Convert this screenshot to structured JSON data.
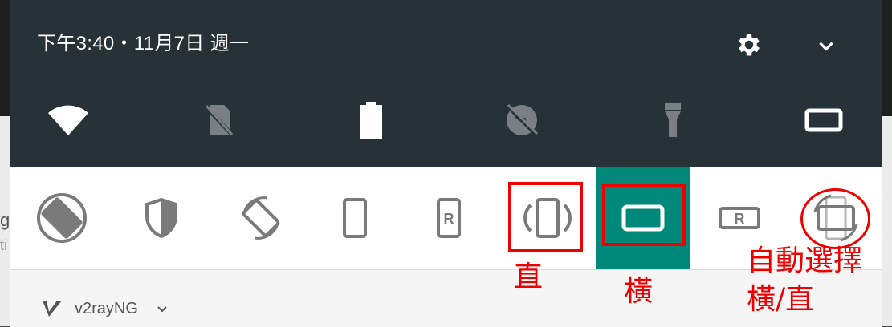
{
  "status": {
    "datetime": "下午3:40・11月7日 週一"
  },
  "header_icons": [
    "settings-gear-icon",
    "chevron-down-icon"
  ],
  "quick_settings": [
    {
      "name": "wifi-icon"
    },
    {
      "name": "no-sim-icon"
    },
    {
      "name": "battery-icon"
    },
    {
      "name": "data-saver-off-icon"
    },
    {
      "name": "flashlight-off-icon"
    },
    {
      "name": "screen-orientation-icon"
    }
  ],
  "rotation_options": [
    {
      "name": "auto-rotate-filled-icon"
    },
    {
      "name": "shield-icon"
    },
    {
      "name": "auto-rotate-icon"
    },
    {
      "name": "portrait-phone-icon"
    },
    {
      "name": "portrait-reverse-icon",
      "letter": "R"
    },
    {
      "name": "portrait-sensor-icon"
    },
    {
      "name": "landscape-icon",
      "selected": true
    },
    {
      "name": "landscape-reverse-icon",
      "letter": "R"
    },
    {
      "name": "auto-landscape-portrait-icon"
    }
  ],
  "notification": {
    "app_name": "v2rayNG"
  },
  "background": {
    "peek_g": "g",
    "peek_ti": "ti"
  },
  "annotations": {
    "portrait": "直",
    "landscape": "橫",
    "auto_line1": "自動選擇",
    "auto_line2": "橫/直"
  },
  "colors": {
    "shade": "#263238",
    "selected": "#00897b",
    "annotation": "#e00000",
    "icon_gray": "#7a7a7a"
  }
}
